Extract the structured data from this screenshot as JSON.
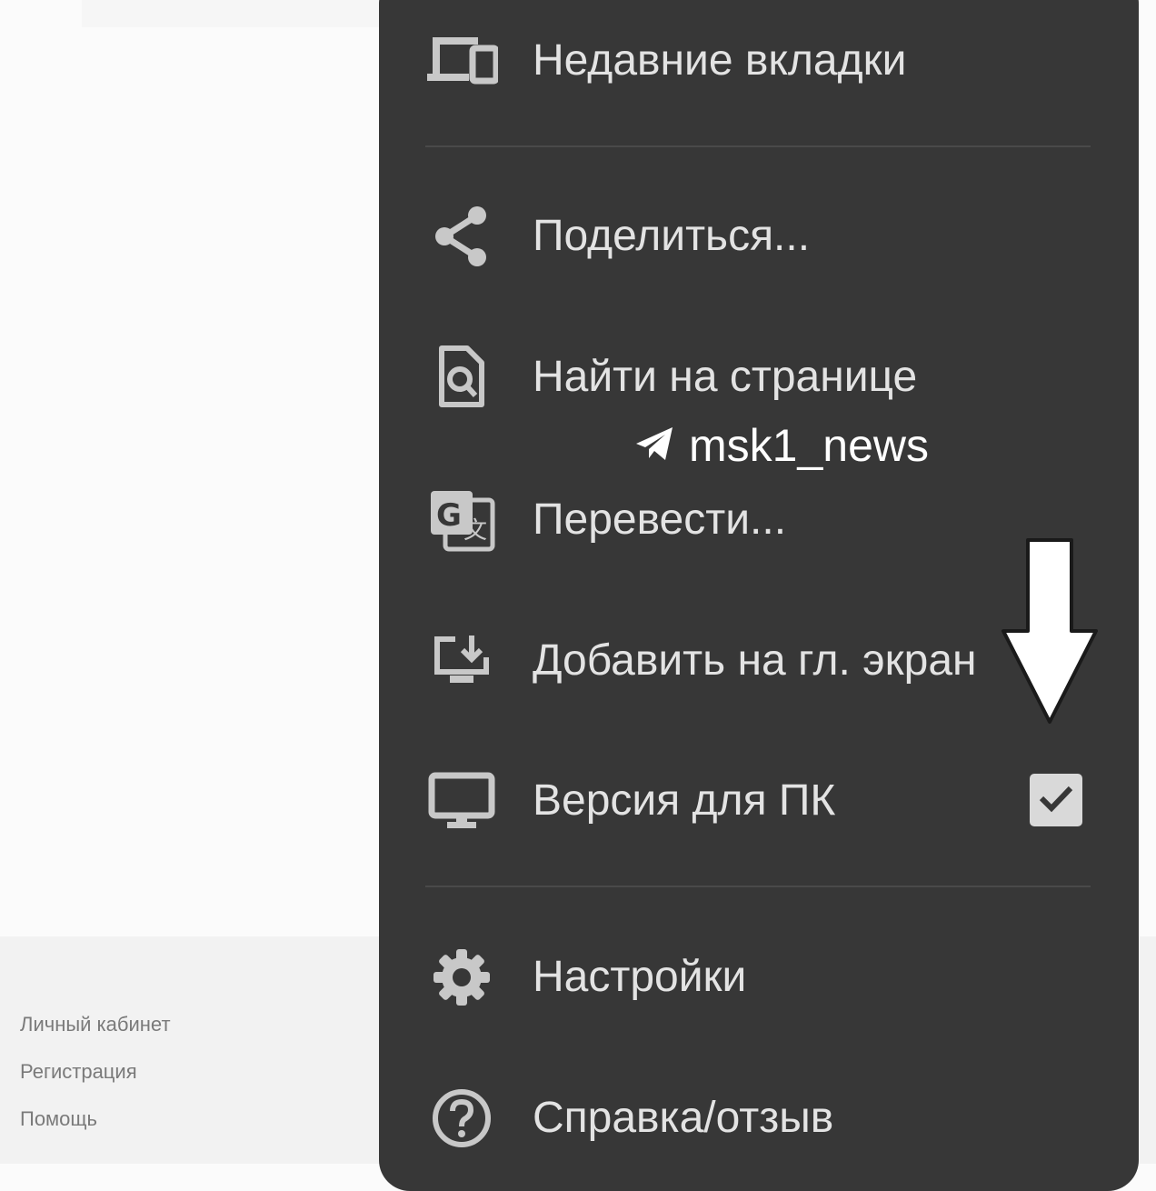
{
  "menu": {
    "items": [
      {
        "label": "Недавние вкладки",
        "icon": "devices-icon"
      },
      {
        "label": "Поделиться...",
        "icon": "share-icon"
      },
      {
        "label": "Найти на странице",
        "icon": "find-in-page-icon"
      },
      {
        "label": "Перевести...",
        "icon": "translate-icon"
      },
      {
        "label": "Добавить на гл. экран",
        "icon": "add-to-home-screen-icon"
      },
      {
        "label": "Версия для ПК",
        "icon": "desktop-icon",
        "checked": true
      },
      {
        "label": "Настройки",
        "icon": "gear-icon"
      },
      {
        "label": "Справка/отзыв",
        "icon": "help-icon"
      }
    ]
  },
  "footer": {
    "links": [
      "Личный кабинет",
      "Регистрация",
      "Помощь"
    ]
  },
  "watermark": {
    "text": "msk1_news",
    "icon": "telegram-icon"
  },
  "colors": {
    "menu_bg": "#373737",
    "menu_text": "#e3e3e3",
    "icon": "#c8c8c8",
    "checkbox_bg": "#d9d9d9"
  }
}
